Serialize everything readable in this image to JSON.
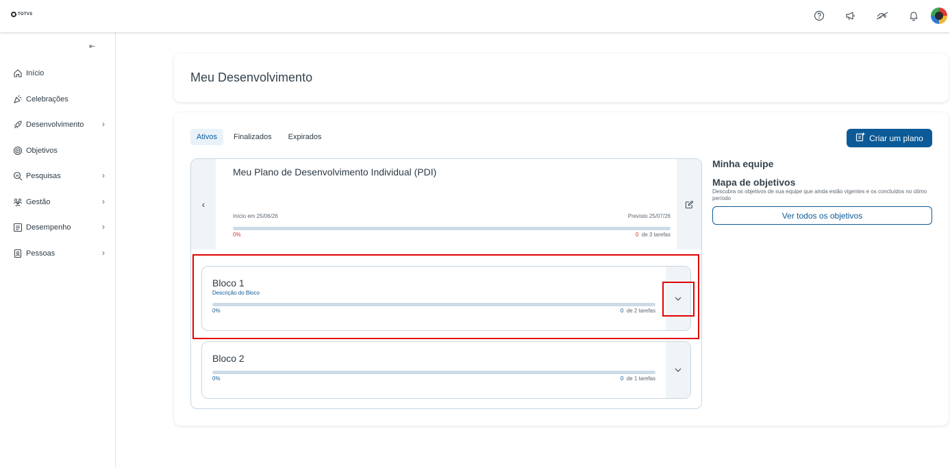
{
  "brand": {
    "logo_text": "TOTVS"
  },
  "topbar": {
    "icons": [
      "help-icon",
      "megaphone-icon",
      "handshake-icon",
      "bell-icon"
    ]
  },
  "sidebar": {
    "items": [
      {
        "label": "Início",
        "icon": "home-icon",
        "has_submenu": false
      },
      {
        "label": "Celebrações",
        "icon": "party-icon",
        "has_submenu": false
      },
      {
        "label": "Desenvolvimento",
        "icon": "rocket-icon",
        "has_submenu": true
      },
      {
        "label": "Objetivos",
        "icon": "target-icon",
        "has_submenu": false
      },
      {
        "label": "Pesquisas",
        "icon": "search-chart-icon",
        "has_submenu": true
      },
      {
        "label": "Gestão",
        "icon": "team-icon",
        "has_submenu": true
      },
      {
        "label": "Desempenho",
        "icon": "scorecard-icon",
        "has_submenu": true
      },
      {
        "label": "Pessoas",
        "icon": "badge-icon",
        "has_submenu": true
      }
    ]
  },
  "page": {
    "title": "Meu Desenvolvimento"
  },
  "tabs": [
    {
      "label": "Ativos",
      "active": true
    },
    {
      "label": "Finalizados",
      "active": false
    },
    {
      "label": "Expirados",
      "active": false
    }
  ],
  "create_button": {
    "label": "Criar um plano"
  },
  "plan": {
    "title": "Meu Plano de Desenvolvimento Individual (PDI)",
    "start_label": "Início em 25/06/26",
    "end_label": "Previsto 25/07/26",
    "percent_label": "0%",
    "progress": 0,
    "done_count": "0",
    "tasks_label": "de 3 tarefas"
  },
  "blocks": [
    {
      "title": "Bloco 1",
      "description": "Descrição do Bloco",
      "percent_label": "0%",
      "progress": 0,
      "done_count": "0",
      "tasks_label": "de 2 tarefas"
    },
    {
      "title": "Bloco 2",
      "description": "",
      "percent_label": "0%",
      "progress": 0,
      "done_count": "0",
      "tasks_label": "de 1 tarefas"
    }
  ],
  "team_panel": {
    "heading": "Minha equipe",
    "map_title": "Mapa de objetivos",
    "map_description": "Descubra os objetivos de sua equipe que ainda estão vigentes e os concluídos no útimo período",
    "view_all_label": "Ver todos os objetivos"
  },
  "colors": {
    "primary": "#0c5a97",
    "danger": "#d0312d",
    "highlight": "#e00000"
  }
}
